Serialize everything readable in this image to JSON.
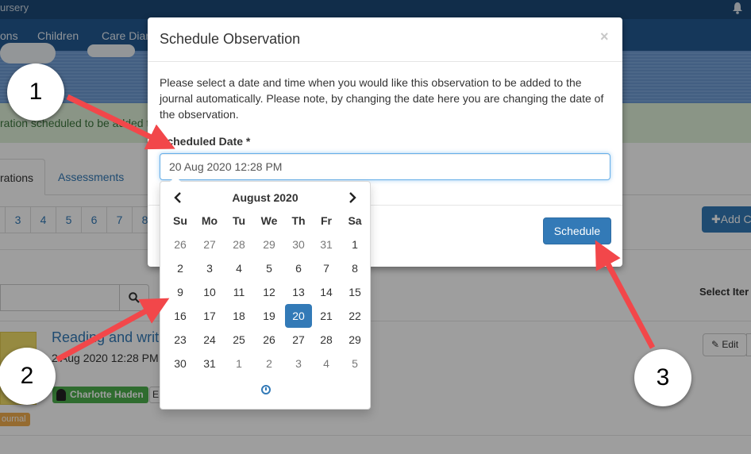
{
  "app": {
    "name_fragment": "ursery",
    "nav": [
      "ons",
      "Children",
      "Care Diar"
    ]
  },
  "background": {
    "alert_text": "ration scheduled to be added t",
    "tabs": [
      "rations",
      "Assessments"
    ],
    "pages": [
      "3",
      "4",
      "5",
      "6",
      "7",
      "8"
    ],
    "add_label": "Add C",
    "select_items_label": "Select Iter",
    "observation": {
      "title": "Reading and writ",
      "date": "2 Aug 2020 12:28 PM",
      "child": "Charlotte Haden",
      "tag_b": "E",
      "journal_badge": "ournal",
      "edit_label": "Edit"
    }
  },
  "modal": {
    "title": "Schedule Observation",
    "close_label": "×",
    "description": "Please select a date and time when you would like this observation to be added to the journal automatically. Please note, by changing the date here you are changing the date of the observation.",
    "field_label": "Scheduled Date *",
    "field_value": "20 Aug 2020 12:28 PM",
    "schedule_label": "Schedule"
  },
  "datepicker": {
    "month": "August 2020",
    "prev_icon": "‹",
    "next_icon": "›",
    "weekdays": [
      "Su",
      "Mo",
      "Tu",
      "We",
      "Th",
      "Fr",
      "Sa"
    ],
    "weeks": [
      [
        "26",
        "27",
        "28",
        "29",
        "30",
        "31",
        "1"
      ],
      [
        "2",
        "3",
        "4",
        "5",
        "6",
        "7",
        "8"
      ],
      [
        "9",
        "10",
        "11",
        "12",
        "13",
        "14",
        "15"
      ],
      [
        "16",
        "17",
        "18",
        "19",
        "20",
        "21",
        "22"
      ],
      [
        "23",
        "24",
        "25",
        "26",
        "27",
        "28",
        "29"
      ],
      [
        "30",
        "31",
        "1",
        "2",
        "3",
        "4",
        "5"
      ]
    ],
    "selected_day": "20",
    "muted_cells": [
      "0-0",
      "0-1",
      "0-2",
      "0-3",
      "0-4",
      "0-5",
      "5-2",
      "5-3",
      "5-4",
      "5-5",
      "5-6"
    ]
  },
  "annotations": {
    "callouts": [
      "1",
      "2",
      "3"
    ],
    "arrow_color": "#f2474a"
  }
}
